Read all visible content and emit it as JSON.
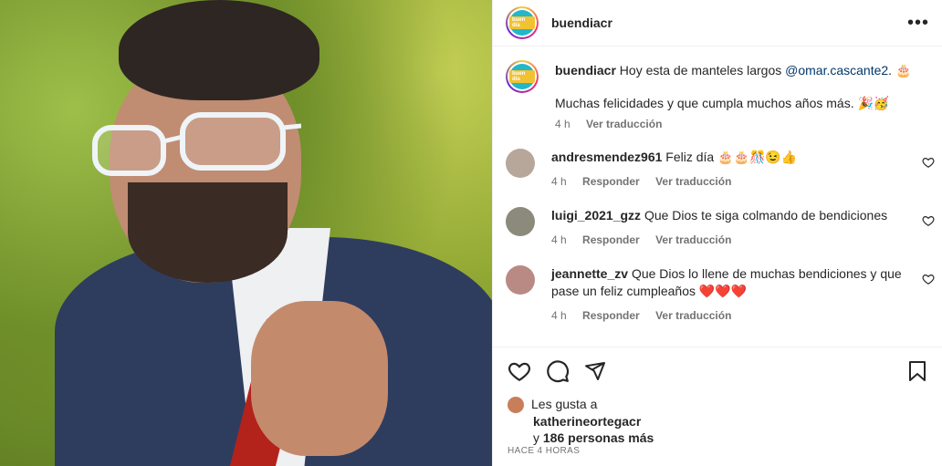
{
  "post": {
    "photo_alt_icon": "portrait-photo",
    "header_username": "buendiacr",
    "header_more": "•••",
    "logo_text": "buen día"
  },
  "caption": {
    "username": "buendiacr",
    "text": "Hoy esta de manteles largos",
    "mention": "@omar.cascante2",
    "after_mention": ". 🎂",
    "line2": "Muchas felicidades y que cumpla muchos años más. 🎉🥳",
    "time": "4 h",
    "translate": "Ver traducción"
  },
  "comments": [
    {
      "username": "andresmendez961",
      "text": "Feliz día 🎂🎂🎊😉👍",
      "time": "4 h",
      "reply": "Responder",
      "translate": "Ver traducción",
      "avatar_color": "#b7a69a"
    },
    {
      "username": "luigi_2021_gzz",
      "text": "Que Dios te siga colmando de bendiciones",
      "time": "4 h",
      "reply": "Responder",
      "translate": "Ver traducción",
      "avatar_color": "#8c8a7a"
    },
    {
      "username": "jeannette_zv",
      "text": "Que Dios lo llene de muchas bendiciones y que pase un feliz cumpleaños ❤️❤️❤️",
      "time": "4 h",
      "reply": "Responder",
      "translate": "Ver traducción",
      "avatar_color": "#b98a84"
    }
  ],
  "likes": {
    "prefix": "Les gusta a",
    "user": "katherineortegacr",
    "and": "y",
    "others": "186 personas más"
  },
  "timestamp": "HACE 4 HORAS"
}
